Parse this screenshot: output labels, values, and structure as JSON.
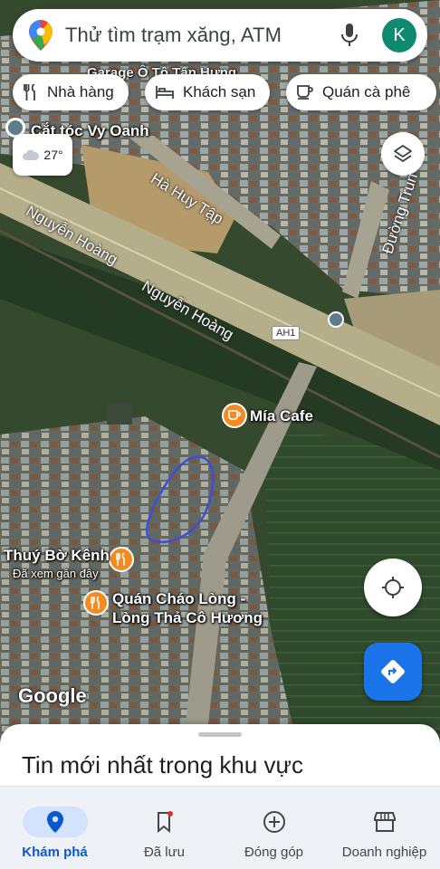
{
  "search": {
    "placeholder": "Thử tìm trạm xăng, ATM",
    "avatar_letter": "K"
  },
  "chips": [
    {
      "label": "Nhà hàng",
      "icon": "fork-knife-icon"
    },
    {
      "label": "Khách sạn",
      "icon": "bed-icon"
    },
    {
      "label": "Quán cà phê",
      "icon": "coffee-cup-icon"
    }
  ],
  "weather": {
    "temperature": "27°",
    "icon": "cloud-icon"
  },
  "map": {
    "labels": {
      "cat_toc": "Cắt tóc Vy Oanh",
      "garage": "Garage Ô Tô Tấn Hưng",
      "ha_huy_tap": "Hà Huy Tập",
      "nguyen_hoang_1": "Nguyễn Hoàng",
      "nguyen_hoang_2": "Nguyễn Hoàng",
      "duong_trung": "Đường Trun",
      "ah1": "AH1",
      "mia_cafe": "Mía Cafe",
      "thuy_bo_kenh": "Thuý Bờ Kênh",
      "thuy_bo_kenh_sub": "Đã xem gần đây",
      "quan_chao_1": "Quán Cháo Lòng -",
      "quan_chao_2": "Lòng Thả Cô Hương"
    },
    "logo": "Google"
  },
  "sheet": {
    "title": "Tin mới nhất trong khu vực"
  },
  "nav": [
    {
      "label": "Khám phá",
      "icon": "location-pin-icon",
      "active": true
    },
    {
      "label": "Đã lưu",
      "icon": "bookmark-icon",
      "active": false
    },
    {
      "label": "Đóng góp",
      "icon": "add-circle-icon",
      "active": false
    },
    {
      "label": "Doanh nghiệp",
      "icon": "storefront-icon",
      "active": false
    }
  ],
  "colors": {
    "accent": "#1a73e8",
    "poi_orange": "#f28b22",
    "avatar": "#0f8a6e"
  }
}
